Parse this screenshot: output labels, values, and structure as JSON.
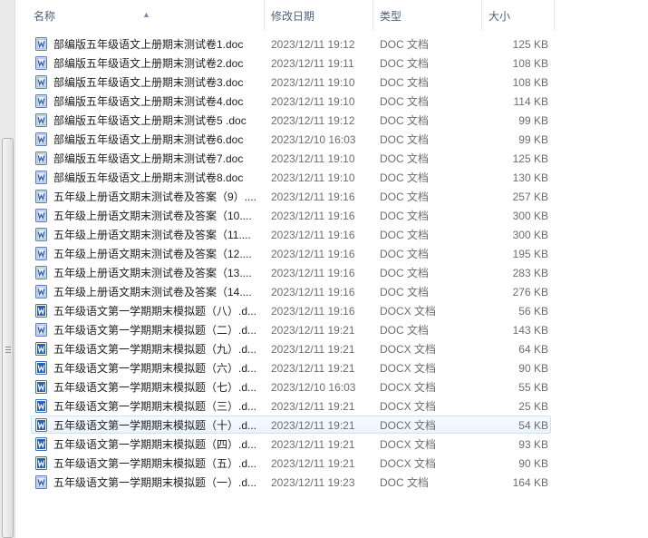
{
  "columns": {
    "name": "名称",
    "date": "修改日期",
    "type": "类型",
    "size": "大小"
  },
  "files": [
    {
      "name": "部编版五年级语文上册期末测试卷1.doc",
      "date": "2023/12/11 19:12",
      "type": "DOC 文档",
      "size": "125 KB",
      "icon": "doc-file-icon"
    },
    {
      "name": "部编版五年级语文上册期末测试卷2.doc",
      "date": "2023/12/11 19:11",
      "type": "DOC 文档",
      "size": "108 KB",
      "icon": "doc-file-icon"
    },
    {
      "name": "部编版五年级语文上册期末测试卷3.doc",
      "date": "2023/12/11 19:10",
      "type": "DOC 文档",
      "size": "108 KB",
      "icon": "doc-file-icon"
    },
    {
      "name": "部编版五年级语文上册期末测试卷4.doc",
      "date": "2023/12/11 19:10",
      "type": "DOC 文档",
      "size": "114 KB",
      "icon": "doc-file-icon"
    },
    {
      "name": "部编版五年级语文上册期末测试卷5 .doc",
      "date": "2023/12/11 19:12",
      "type": "DOC 文档",
      "size": "99 KB",
      "icon": "doc-file-icon"
    },
    {
      "name": "部编版五年级语文上册期末测试卷6.doc",
      "date": "2023/12/10 16:03",
      "type": "DOC 文档",
      "size": "99 KB",
      "icon": "doc-file-icon"
    },
    {
      "name": "部编版五年级语文上册期末测试卷7.doc",
      "date": "2023/12/11 19:10",
      "type": "DOC 文档",
      "size": "125 KB",
      "icon": "doc-file-icon"
    },
    {
      "name": "部编版五年级语文上册期末测试卷8.doc",
      "date": "2023/12/11 19:10",
      "type": "DOC 文档",
      "size": "130 KB",
      "icon": "doc-file-icon"
    },
    {
      "name": "五年级上册语文期末测试卷及答案（9）....",
      "date": "2023/12/11 19:16",
      "type": "DOC 文档",
      "size": "257 KB",
      "icon": "doc-file-icon"
    },
    {
      "name": "五年级上册语文期末测试卷及答案（10....",
      "date": "2023/12/11 19:16",
      "type": "DOC 文档",
      "size": "300 KB",
      "icon": "doc-file-icon"
    },
    {
      "name": "五年级上册语文期末测试卷及答案（11....",
      "date": "2023/12/11 19:16",
      "type": "DOC 文档",
      "size": "300 KB",
      "icon": "doc-file-icon"
    },
    {
      "name": "五年级上册语文期末测试卷及答案（12....",
      "date": "2023/12/11 19:16",
      "type": "DOC 文档",
      "size": "195 KB",
      "icon": "doc-file-icon"
    },
    {
      "name": "五年级上册语文期末测试卷及答案（13....",
      "date": "2023/12/11 19:16",
      "type": "DOC 文档",
      "size": "283 KB",
      "icon": "doc-file-icon"
    },
    {
      "name": "五年级上册语文期末测试卷及答案（14....",
      "date": "2023/12/11 19:16",
      "type": "DOC 文档",
      "size": "276 KB",
      "icon": "doc-file-icon"
    },
    {
      "name": "五年级语文第一学期期末模拟题（八）.d...",
      "date": "2023/12/11 19:16",
      "type": "DOCX 文档",
      "size": "56 KB",
      "icon": "docx-file-icon"
    },
    {
      "name": "五年级语文第一学期期末模拟题（二）.d...",
      "date": "2023/12/11 19:21",
      "type": "DOC 文档",
      "size": "143 KB",
      "icon": "doc-file-icon"
    },
    {
      "name": "五年级语文第一学期期末模拟题（九）.d...",
      "date": "2023/12/11 19:21",
      "type": "DOCX 文档",
      "size": "64 KB",
      "icon": "docx-file-icon"
    },
    {
      "name": "五年级语文第一学期期末模拟题（六）.d...",
      "date": "2023/12/11 19:21",
      "type": "DOCX 文档",
      "size": "90 KB",
      "icon": "docx-file-icon"
    },
    {
      "name": "五年级语文第一学期期末模拟题（七）.d...",
      "date": "2023/12/10 16:03",
      "type": "DOCX 文档",
      "size": "55 KB",
      "icon": "docx-file-icon"
    },
    {
      "name": "五年级语文第一学期期末模拟题（三）.d...",
      "date": "2023/12/11 19:21",
      "type": "DOCX 文档",
      "size": "25 KB",
      "icon": "docx-file-icon"
    },
    {
      "name": "五年级语文第一学期期末模拟题（十）.d...",
      "date": "2023/12/11 19:21",
      "type": "DOCX 文档",
      "size": "54 KB",
      "icon": "docx-file-icon",
      "selected": true
    },
    {
      "name": "五年级语文第一学期期末模拟题（四）.d...",
      "date": "2023/12/11 19:21",
      "type": "DOCX 文档",
      "size": "93 KB",
      "icon": "docx-file-icon"
    },
    {
      "name": "五年级语文第一学期期末模拟题（五）.d...",
      "date": "2023/12/11 19:21",
      "type": "DOCX 文档",
      "size": "90 KB",
      "icon": "docx-file-icon"
    },
    {
      "name": "五年级语文第一学期期末模拟题（一）.d...",
      "date": "2023/12/11 19:23",
      "type": "DOC 文档",
      "size": "164 KB",
      "icon": "doc-file-icon"
    }
  ]
}
